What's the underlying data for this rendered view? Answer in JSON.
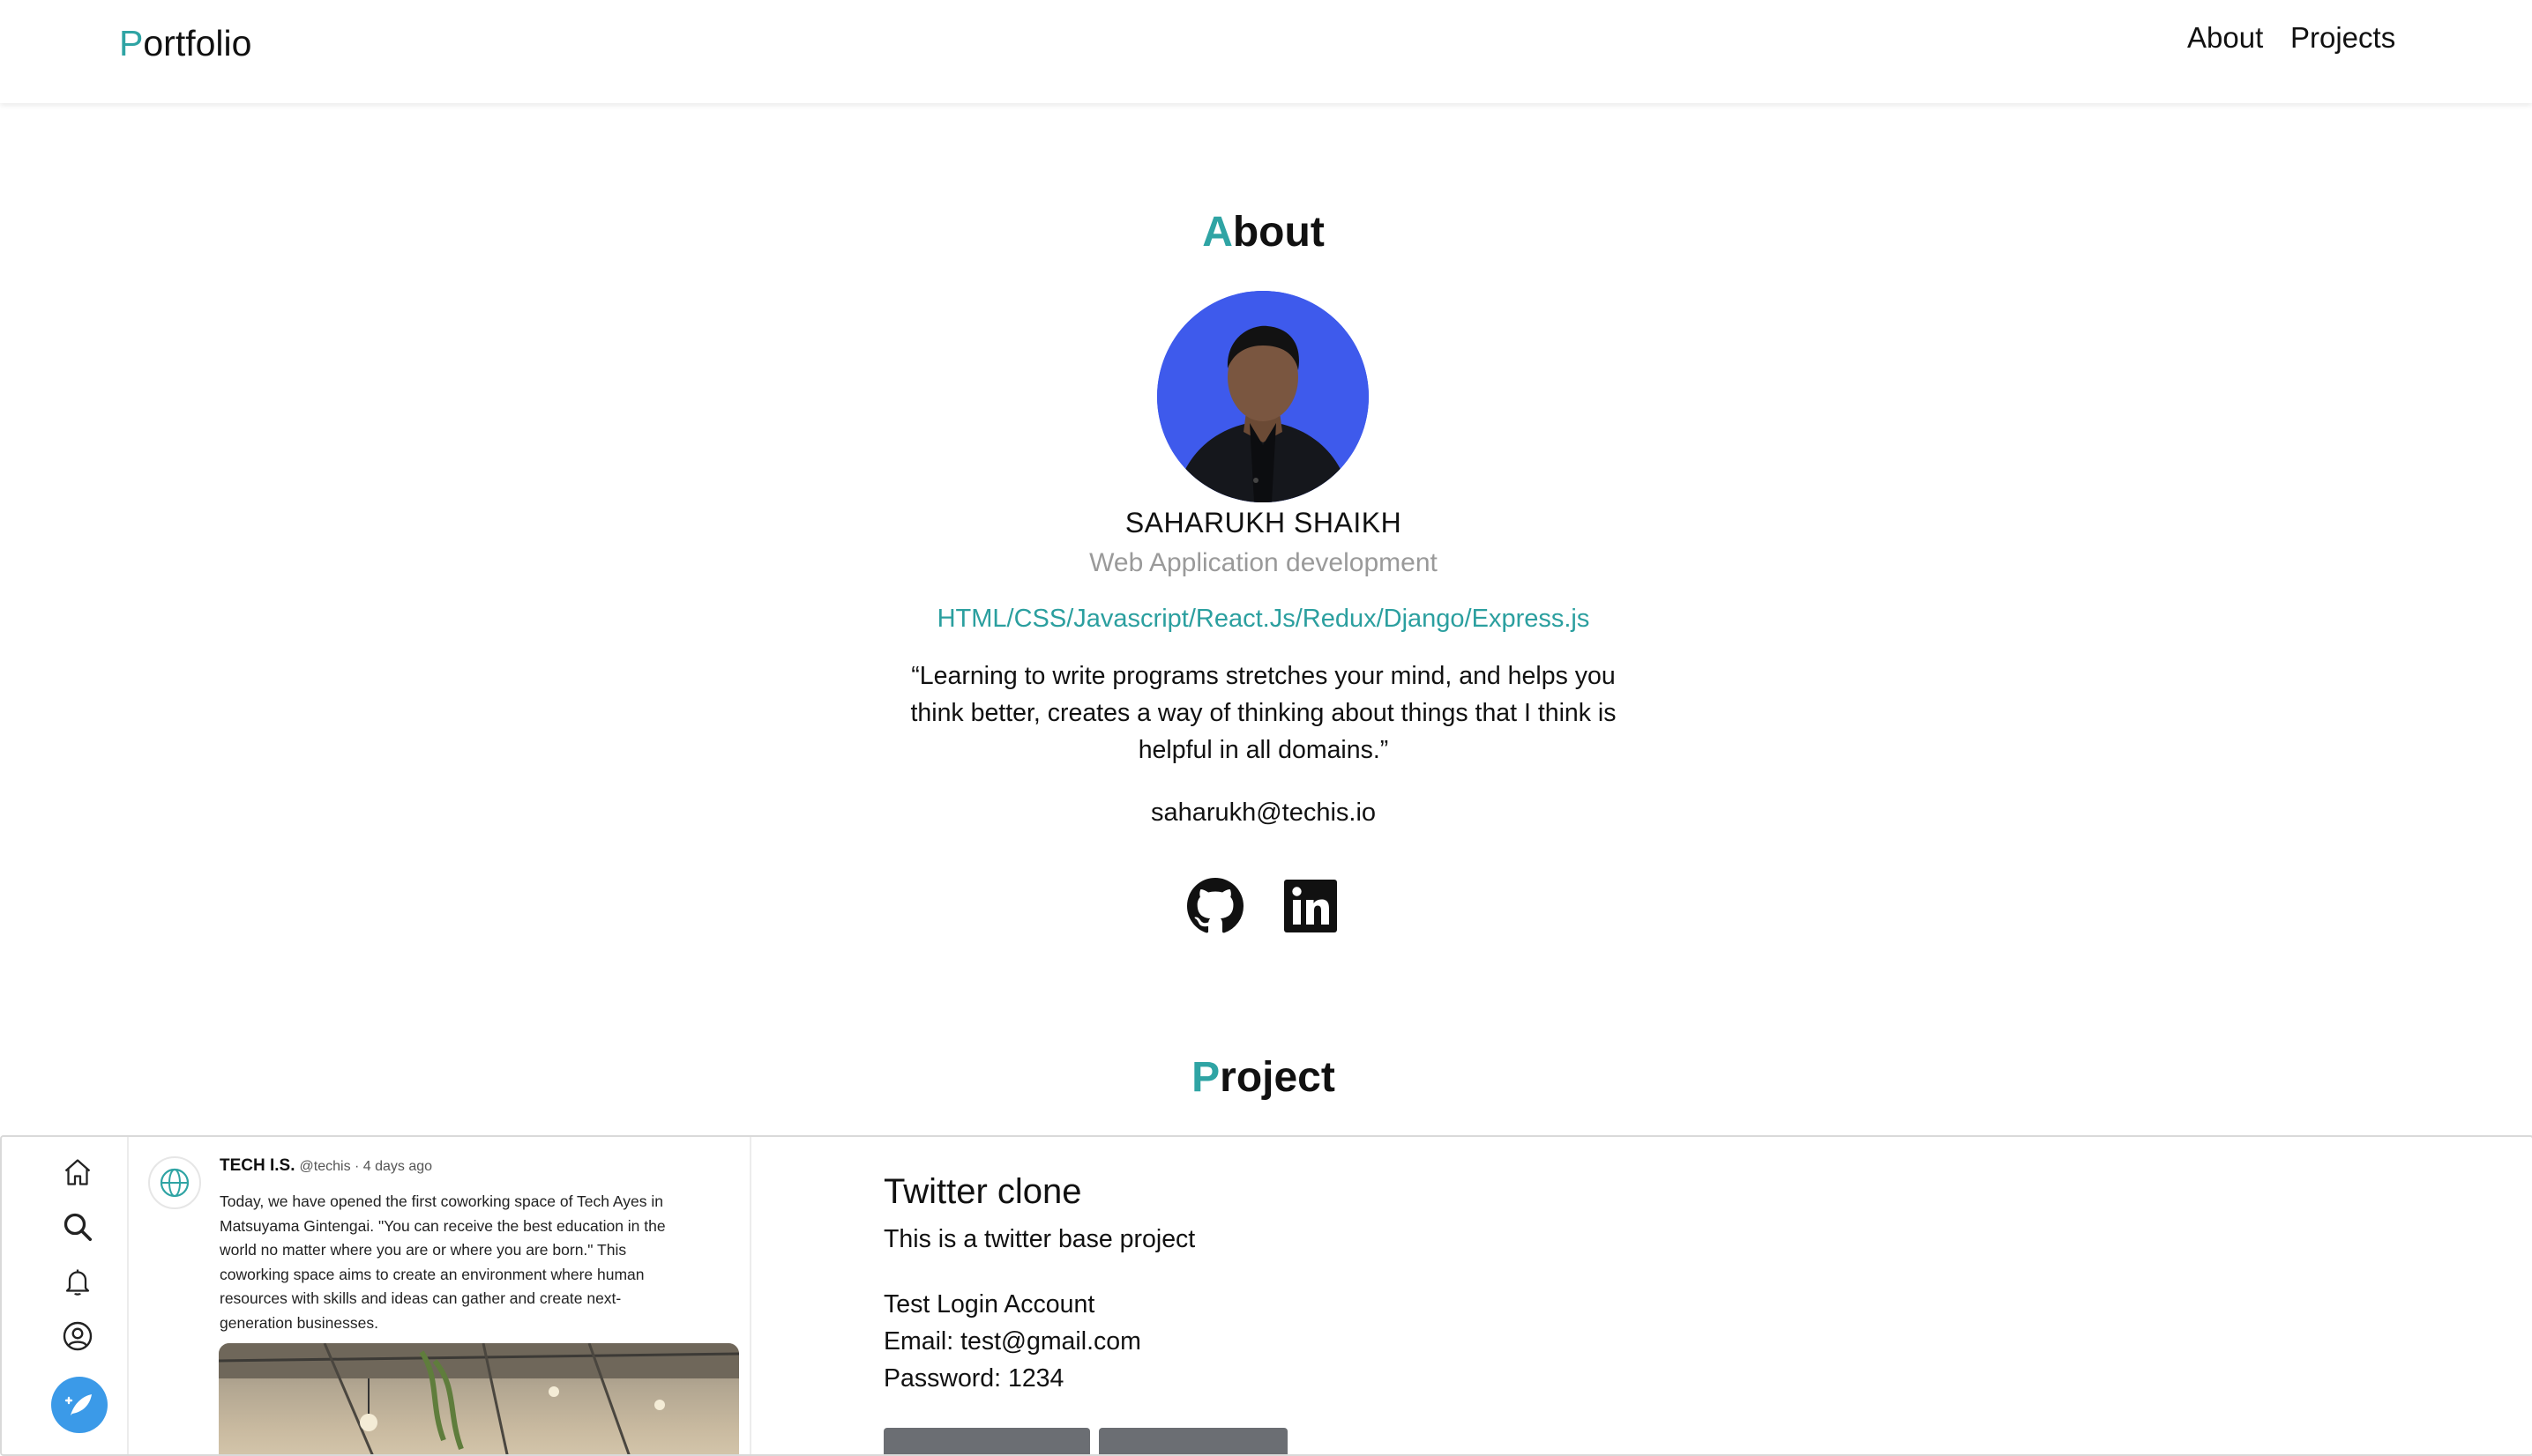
{
  "navbar": {
    "brand_initial": "P",
    "brand_rest": "ortfolio",
    "links": [
      "About",
      "Projects"
    ]
  },
  "about": {
    "title_initial": "A",
    "title_rest": "bout",
    "name": "SAHARUKH SHAIKH",
    "role": "Web Application development",
    "skills": "HTML/CSS/Javascript/React.Js/Redux/Django/Express.js",
    "quote_lines": [
      "“Learning to write programs stretches your mind, and helps you",
      "think better, creates a way of thinking about things that I think is",
      "helpful in all domains.”"
    ],
    "email": "saharukh@techis.io",
    "social_icons": [
      "github-icon",
      "linkedin-icon"
    ]
  },
  "project": {
    "title_initial": "P",
    "title_rest": "roject",
    "screenshot": {
      "author": "TECH I.S.",
      "meta": "@techis · 4 days ago",
      "text_lines": [
        "Today, we have opened the first coworking space of Tech Ayes in",
        "Matsuyama Gintengai. \"You can receive the best education in the",
        "world no matter where you are or where you are born.\" This",
        "coworking space aims to create an environment where human",
        "resources with skills and ideas can gather and create next-",
        "generation businesses."
      ],
      "sidebar_icons": [
        "home-icon",
        "search-icon",
        "bell-icon",
        "user-icon",
        "compose-icon"
      ]
    },
    "card": {
      "name": "Twitter clone",
      "description": "This is a twitter base project",
      "login_heading": "Test Login Account",
      "email_line": "Email: test@gmail.com",
      "password_line": "Password: 1234"
    }
  },
  "colors": {
    "accent": "#2fa4a4",
    "avatar_bg": "#3e5aec",
    "compose_button": "#3b9ae8",
    "card_button": "#6b6e73"
  }
}
